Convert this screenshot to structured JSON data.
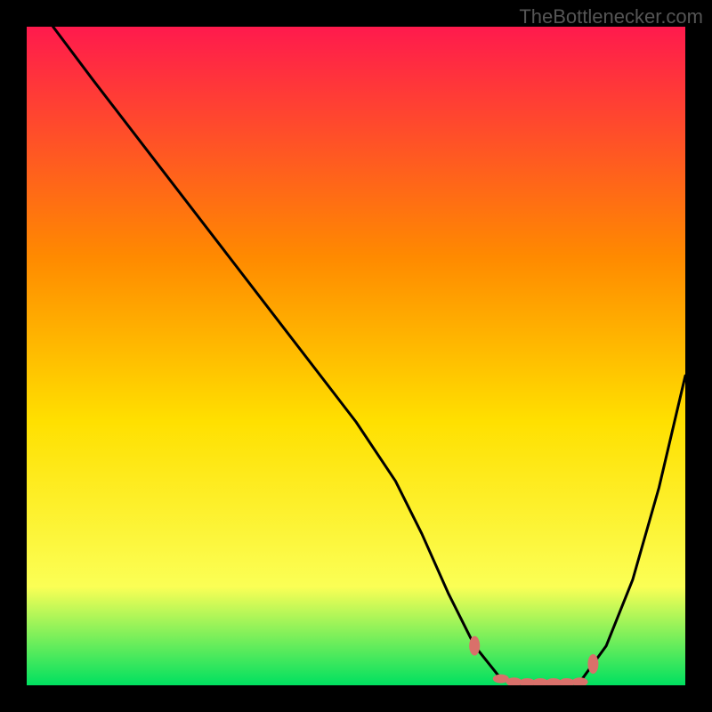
{
  "watermark": "TheBottlenecker.com",
  "chart_data": {
    "type": "line",
    "title": "",
    "xlabel": "",
    "ylabel": "",
    "xlim": [
      0,
      100
    ],
    "ylim": [
      0,
      100
    ],
    "background_gradient": {
      "top": "#ff1a4d",
      "mid_upper": "#ff8a00",
      "mid": "#ffe000",
      "mid_lower": "#fbff55",
      "bottom": "#00e060"
    },
    "series": [
      {
        "name": "bottleneck-curve",
        "x": [
          4,
          10,
          20,
          30,
          40,
          50,
          56,
          60,
          64,
          68,
          72,
          76,
          80,
          84,
          88,
          92,
          96,
          100
        ],
        "y": [
          100,
          92,
          79,
          66,
          53,
          40,
          31,
          23,
          14,
          6,
          1,
          0,
          0,
          0.5,
          6,
          16,
          30,
          47
        ]
      }
    ],
    "flat_region": {
      "x_start": 68,
      "x_end": 86,
      "marker_color": "#d9706a",
      "markers_x": [
        68,
        72,
        74,
        76,
        78,
        80,
        82,
        84,
        86
      ]
    }
  }
}
